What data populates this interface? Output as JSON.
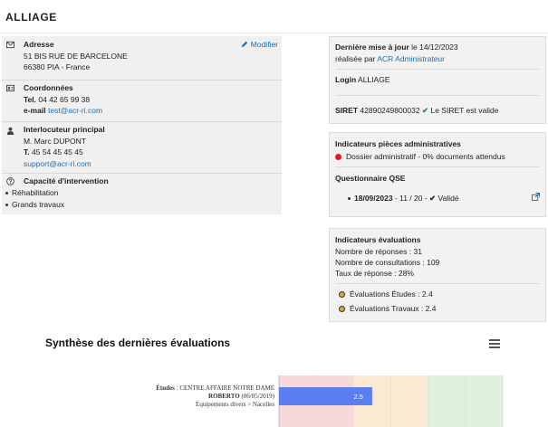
{
  "header": {
    "title": "ALLIAGE"
  },
  "left": {
    "modify_label": "Modifier",
    "address": {
      "heading": "Adresse",
      "line1": "51 BIS RUE DE BARCELONE",
      "line2": "66380 PIA - France"
    },
    "contact": {
      "heading": "Coordonnées",
      "tel_label": "Tel.",
      "tel_value": "04 42 65 99 38",
      "email_label": "e-mail",
      "email_value": "test@acr-ri.com"
    },
    "main_contact": {
      "heading": "Interlocuteur principal",
      "name": "M. Marc DUPONT",
      "tel_label": "T.",
      "tel_value": "45 54 45 45 45",
      "email": "support@acr-ri.com"
    },
    "capacity": {
      "heading": "Capacité d'intervention",
      "items": [
        "Réhabilitation",
        "Grands travaux"
      ]
    }
  },
  "update_panel": {
    "last_update_label": "Dernière mise à jour",
    "last_update_suffix": "le 14/12/2023",
    "made_by_prefix": "réalisée par",
    "made_by_user": "ACR Administrateur",
    "login_label": "Login",
    "login_value": "ALLIAGE",
    "siret_label": "SIRET",
    "siret_value": "42890249800032",
    "siret_status": "Le SIRET est valide"
  },
  "admin_panel": {
    "title": "Indicateurs pièces administratives",
    "dossier_text": "Dossier administratif - 0% documents attendus",
    "qse_title": "Questionnaire QSE",
    "qse_date": "18/09/2023",
    "qse_score": "- 11 / 20 -",
    "qse_status": "Validé"
  },
  "eval_panel": {
    "title": "Indicateurs évaluations",
    "responses": "Nombre de réponses : 31",
    "consultations": "Nombre de consultations : 109",
    "rate": "Taux de réponse : 28%",
    "studies": "Évaluations Études : 2.4",
    "works": "Évaluations Travaux : 2.4"
  },
  "chart_title": "Synthèse des dernières évaluations",
  "chart_data": {
    "type": "bar",
    "orientation": "horizontal",
    "categories": [
      {
        "line1_bold": "Études",
        "line1_rest": " : CENTRE AFFAIRE NOTRE DAME",
        "line2_bold": "ROBERTO",
        "line2_rest": " (06/05/2019)",
        "line3": "Equipements divers > Nacelles"
      }
    ],
    "values": [
      2.5
    ],
    "value_labels": [
      "2.5"
    ],
    "xlim": [
      0,
      6
    ],
    "bands": [
      {
        "from": 0,
        "to": 1,
        "color": "#f6d8d8"
      },
      {
        "from": 1,
        "to": 2,
        "color": "#f6d8d8"
      },
      {
        "from": 2,
        "to": 3,
        "color": "#fbe9d4"
      },
      {
        "from": 3,
        "to": 4,
        "color": "#fbe9d4"
      },
      {
        "from": 4,
        "to": 5,
        "color": "#dff1da"
      },
      {
        "from": 5,
        "to": 6,
        "color": "#dff1da"
      }
    ],
    "bar_color": "#5b7ff0"
  }
}
